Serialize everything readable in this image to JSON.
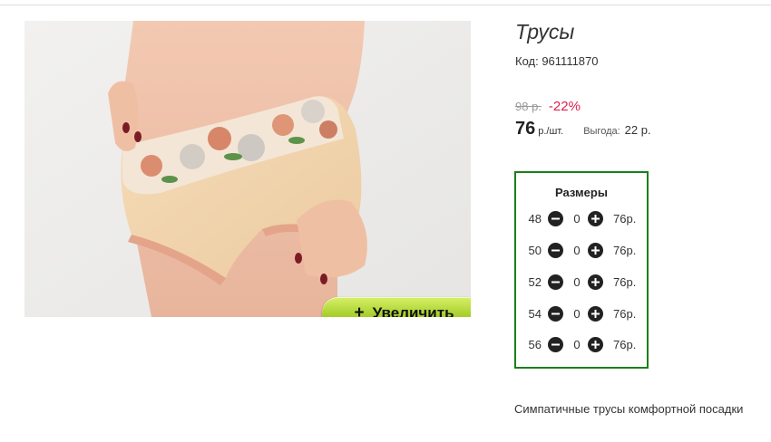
{
  "product": {
    "title": "Трусы",
    "code": "Код: 961111870",
    "old_price": "98 р.",
    "discount": "-22%",
    "price": "76",
    "price_unit": "р./шт.",
    "savings_label": "Выгода:",
    "savings_value": "22 р.",
    "description": "Симпатичные трусы комфортной посадки"
  },
  "image": {
    "zoom_label": "Увеличить"
  },
  "sizes": {
    "title": "Размеры",
    "rows": [
      {
        "size": "48",
        "qty": "0",
        "price": "76р."
      },
      {
        "size": "50",
        "qty": "0",
        "price": "76р."
      },
      {
        "size": "52",
        "qty": "0",
        "price": "76р."
      },
      {
        "size": "54",
        "qty": "0",
        "price": "76р."
      },
      {
        "size": "56",
        "qty": "0",
        "price": "76р."
      }
    ]
  },
  "colors": {
    "discount": "#e0204f",
    "sizes_border": "#1a7f1a",
    "zoom_button": "#a9d12e"
  },
  "icons": {
    "minus": "minus-circle-icon",
    "plus": "plus-circle-icon"
  }
}
